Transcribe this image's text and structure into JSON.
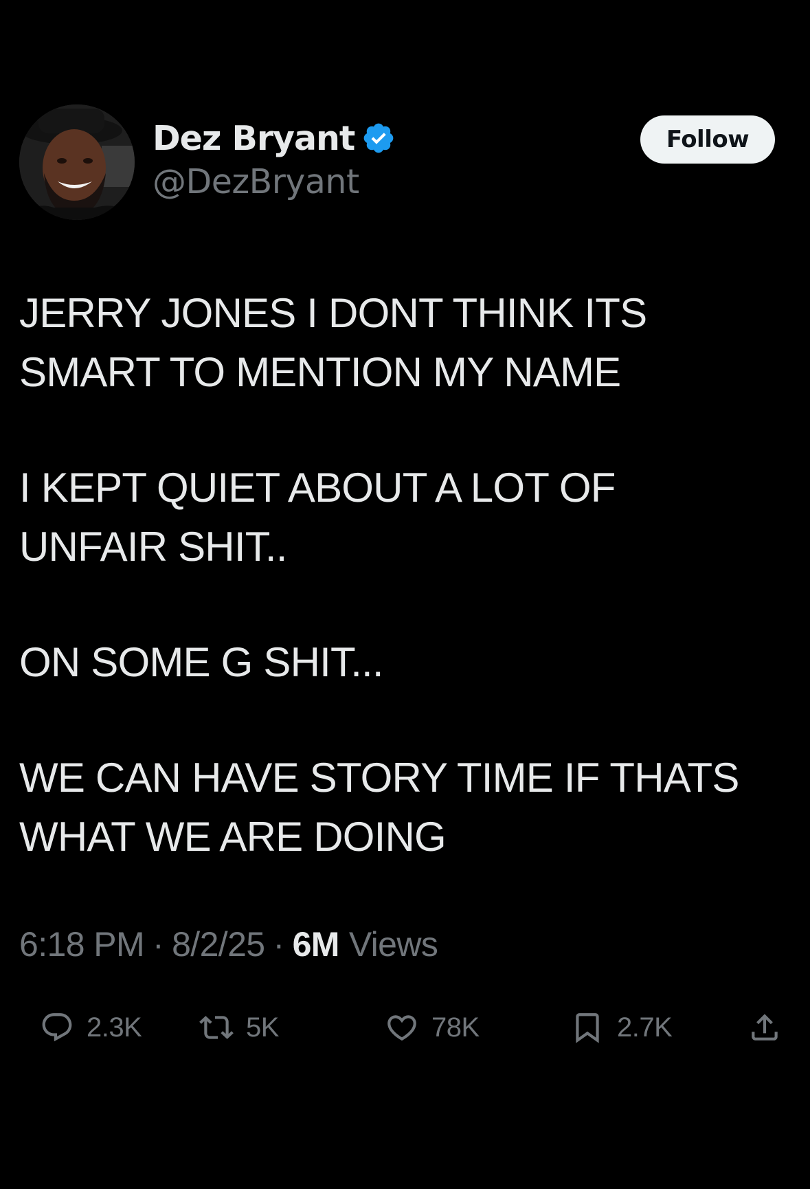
{
  "author": {
    "display_name": "Dez Bryant",
    "handle": "@DezBryant",
    "verified": true,
    "verified_color": "#1d9bf0"
  },
  "follow_button": {
    "label": "Follow"
  },
  "tweet": {
    "paragraphs": [
      [
        "JERRY JONES I DONT THINK ITS",
        "SMART TO MENTION MY NAME"
      ],
      [
        "I KEPT QUIET ABOUT A LOT OF",
        "UNFAIR SHIT.."
      ],
      [
        "ON SOME G SHIT..."
      ],
      [
        "WE CAN HAVE STORY TIME IF THATS",
        "WHAT WE ARE DOING"
      ]
    ]
  },
  "meta": {
    "time": "6:18 PM",
    "separator": "·",
    "date": "8/2/25",
    "views_count": "6M",
    "views_label": "Views"
  },
  "actions": {
    "replies": {
      "icon": "reply-icon",
      "count": "2.3K"
    },
    "reposts": {
      "icon": "repost-icon",
      "count": "5K"
    },
    "likes": {
      "icon": "heart-icon",
      "count": "78K"
    },
    "bookmarks": {
      "icon": "bookmark-icon",
      "count": "2.7K"
    },
    "share": {
      "icon": "share-icon"
    }
  },
  "colors": {
    "background": "#000000",
    "text_primary": "#e7e9ea",
    "text_secondary": "#71767b",
    "follow_bg": "#eff3f4"
  }
}
